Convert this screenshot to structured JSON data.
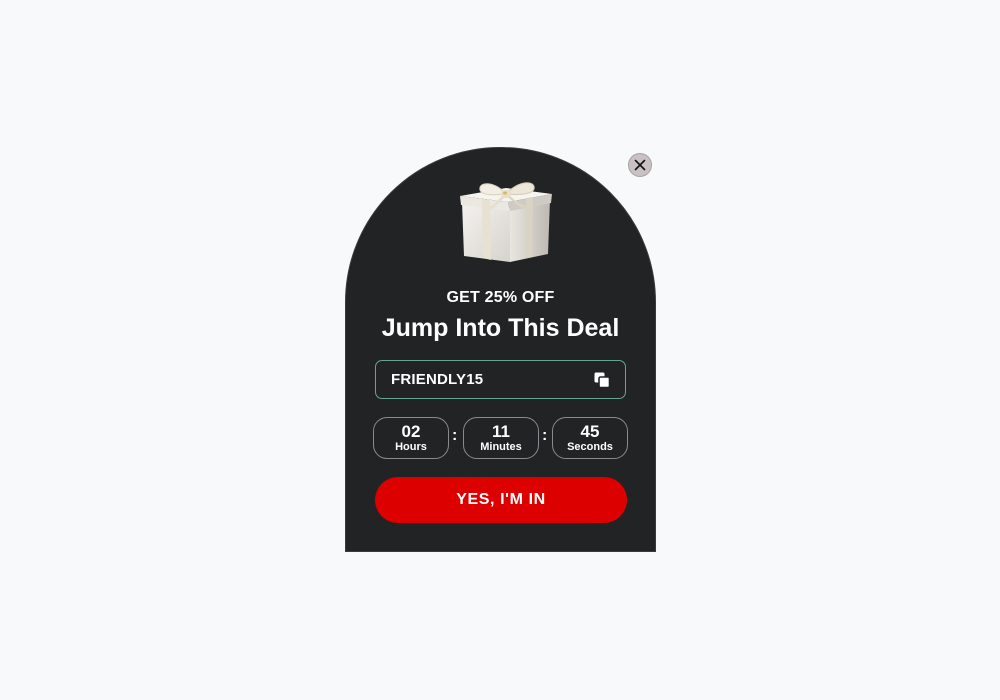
{
  "popup": {
    "close_icon": "close-icon",
    "gift_icon": "gift-box-icon",
    "eyebrow": "GET 25% OFF",
    "headline": "Jump Into This Deal",
    "coupon": {
      "code": "FRIENDLY15",
      "copy_icon": "copy-icon"
    },
    "countdown": {
      "hours": {
        "value": "02",
        "label": "Hours"
      },
      "minutes": {
        "value": "11",
        "label": "Minutes"
      },
      "seconds": {
        "value": "45",
        "label": "Seconds"
      },
      "separator": ":"
    },
    "cta_label": "YES, I'M IN"
  },
  "colors": {
    "background": "#f7f9fb",
    "popup_bg": "#222325",
    "accent_border": "#66a58f",
    "cta": "#dc0000",
    "close_bg": "#c9c1c3"
  }
}
